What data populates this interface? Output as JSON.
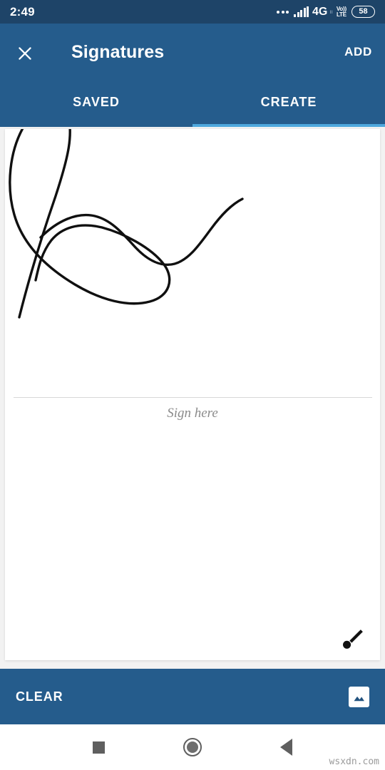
{
  "status_bar": {
    "time": "2:49",
    "network_label": "4G",
    "sim_indicator": "ıı",
    "volte_top": "Vo))",
    "volte_bottom": "LTE",
    "battery_level": "58",
    "icons": [
      "more-dots-icon",
      "signal-bars-icon",
      "volte-icon",
      "battery-icon"
    ],
    "background_color": "#1e4468"
  },
  "app_bar": {
    "close_icon": "close-icon",
    "title": "Signatures",
    "action_label": "ADD",
    "background_color": "#255c8c"
  },
  "tabs": {
    "items": [
      {
        "label": "SAVED",
        "active": false
      },
      {
        "label": "CREATE",
        "active": true
      }
    ],
    "indicator_color": "#4ea8dd"
  },
  "signature_pad": {
    "hint_text": "Sign here",
    "has_drawing": true,
    "stroke_color": "#101010",
    "brush_icon": "paintbrush-icon",
    "line_color": "#d8d8d8"
  },
  "bottom_bar": {
    "clear_label": "CLEAR",
    "image_icon": "image-picker-icon",
    "background_color": "#255c8c"
  },
  "nav_bar": {
    "recents": "square-recents-icon",
    "home": "circle-home-icon",
    "back": "triangle-back-icon"
  },
  "watermark": {
    "text": "wsxdn.com"
  }
}
